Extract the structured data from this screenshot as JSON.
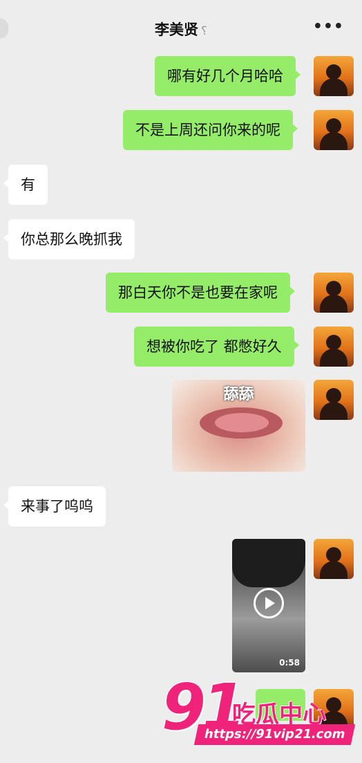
{
  "header": {
    "title": "李美贤",
    "ear_icon": "ear-icon",
    "more_label": "•••"
  },
  "messages": [
    {
      "side": "right",
      "text": "哪有好几个月哈哈"
    },
    {
      "side": "right",
      "text": "不是上周还问你来的呢"
    },
    {
      "side": "left",
      "text": "有"
    },
    {
      "side": "left",
      "text": "你总那么晚抓我"
    },
    {
      "side": "right",
      "text": "那白天你不是也要在家呢"
    },
    {
      "side": "right",
      "text": "想被你吃了 都憋好久"
    },
    {
      "side": "right",
      "type": "sticker",
      "caption": "舔舔"
    },
    {
      "side": "left",
      "text": "来事了呜呜"
    },
    {
      "side": "right",
      "type": "video",
      "duration": "0:58"
    }
  ],
  "watermark": {
    "number": "91",
    "text": "吃瓜中心",
    "url": "https://91vip21.com",
    "color": "#f0237a"
  },
  "colors": {
    "background": "#ededed",
    "outgoing_bubble": "#95ec69",
    "incoming_bubble": "#ffffff"
  }
}
